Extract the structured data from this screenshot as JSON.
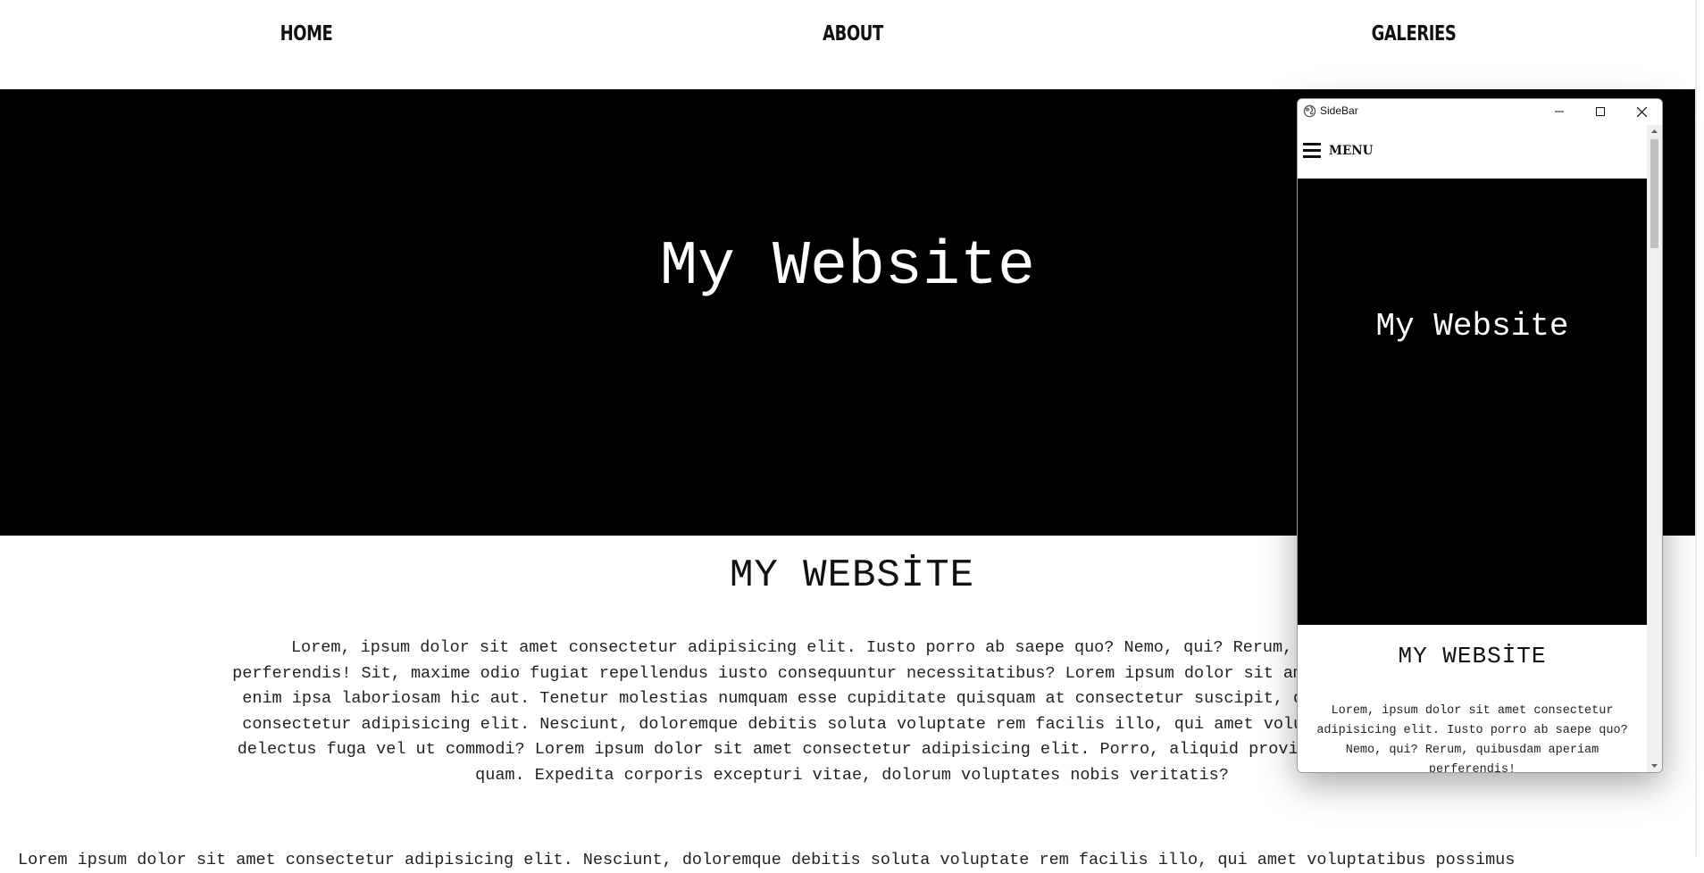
{
  "nav": {
    "home": "HOME",
    "about": "ABOUT",
    "galleries": "GALERIES"
  },
  "hero": {
    "title": "My Website"
  },
  "section": {
    "heading": "MY WEBSİTE",
    "para_lines": [
      "Lorem, ipsum dolor sit amet consectetur adipisicing elit. Iusto porro ab saepe quo? Nemo, qui? Rerum, quibusdam aperiam",
      "perferendis! Sit, maxime odio fugiat repellendus iusto consequuntur necessitatibus? Lorem ipsum dolor sit amet consectetur, a",
      "enim ipsa laboriosam hic aut. Tenetur molestias numquam esse cupiditate quisquam at consectetur suscipit, distinctio in rer",
      "consectetur adipisicing elit. Nesciunt, doloremque debitis soluta voluptate rem facilis illo, qui amet voluptatibus possimu",
      "delectus fuga vel ut commodi? Lorem ipsum dolor sit amet consectetur adipisicing elit. Porro, aliquid provident quidem, opti",
      "quam. Expedita corporis excepturi vitae, dolorum voluptates nobis veritatis?"
    ],
    "para2_line": "Lorem ipsum dolor sit amet consectetur adipisicing elit. Nesciunt, doloremque debitis soluta voluptate rem facilis illo, qui amet voluptatibus possimus"
  },
  "sidebar_window": {
    "title": "SideBar",
    "menu_label": "MENU",
    "hero_title": "My Website",
    "heading": "MY WEBSİTE",
    "para": "Lorem, ipsum dolor sit amet consectetur adipisicing elit. Iusto porro ab saepe quo? Nemo, qui? Rerum, quibusdam aperiam perferendis!"
  },
  "colors": {
    "hero_bg": "#000000",
    "page_bg": "#ffffff",
    "text": "#222222"
  }
}
